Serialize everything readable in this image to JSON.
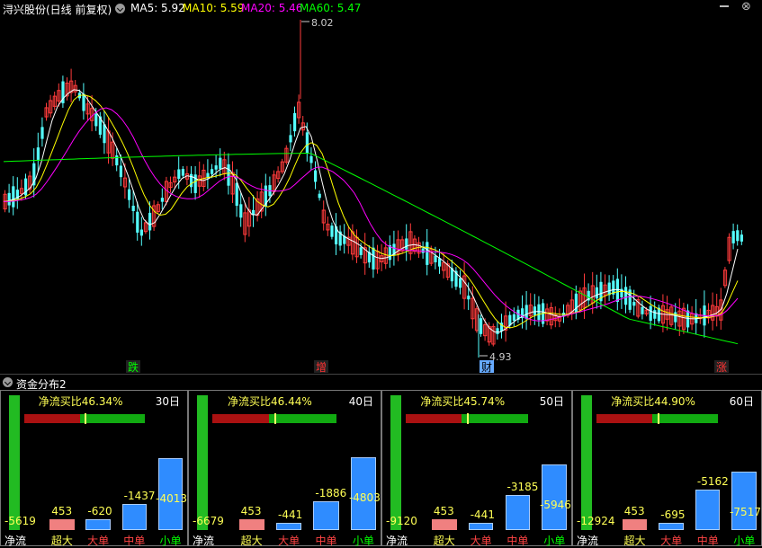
{
  "header": {
    "stock_name": "浔兴股份(日线 前复权)",
    "ma5": "MA5: 5.92",
    "ma10": "MA10: 5.59",
    "ma20": "MA20: 5.46",
    "ma60": "MA60: 5.47",
    "colors": {
      "ma5": "#ffffff",
      "ma10": "#ffff00",
      "ma20": "#ff00ff",
      "ma60": "#00ff00"
    }
  },
  "kline": {
    "high_label": "8.02",
    "low_label": "4.93",
    "markers": [
      {
        "text": "跌",
        "color": "#00ff00",
        "bg": "#222"
      },
      {
        "text": "增",
        "color": "#ff3333",
        "bg": "#222"
      },
      {
        "text": "财",
        "color": "#000000",
        "bg": "#66aaff"
      },
      {
        "text": "涨",
        "color": "#ff3333",
        "bg": "#222"
      }
    ]
  },
  "fund_section": {
    "title": "资金分布2",
    "panels": [
      {
        "title": "净流买比46.34%",
        "days": "30日",
        "bars": [
          {
            "label": "净流",
            "value": "-5619"
          },
          {
            "label": "超大",
            "value": "453"
          },
          {
            "label": "大单",
            "value": "-620"
          },
          {
            "label": "中单",
            "value": "-1437"
          },
          {
            "label": "小单",
            "value": "-4013"
          }
        ]
      },
      {
        "title": "净流买比46.44%",
        "days": "40日",
        "bars": [
          {
            "label": "净流",
            "value": "-6679"
          },
          {
            "label": "超大",
            "value": "453"
          },
          {
            "label": "大单",
            "value": "-441"
          },
          {
            "label": "中单",
            "value": "-1886"
          },
          {
            "label": "小单",
            "value": "-4803"
          }
        ]
      },
      {
        "title": "净流买比45.74%",
        "days": "50日",
        "bars": [
          {
            "label": "净流",
            "value": "-9120"
          },
          {
            "label": "超大",
            "value": "453"
          },
          {
            "label": "大单",
            "value": "-441"
          },
          {
            "label": "中单",
            "value": "-3185"
          },
          {
            "label": "小单",
            "value": "-5946"
          }
        ]
      },
      {
        "title": "净流买比44.90%",
        "days": "60日",
        "bars": [
          {
            "label": "净流",
            "value": "-12924"
          },
          {
            "label": "超大",
            "value": "453"
          },
          {
            "label": "大单",
            "value": "-695"
          },
          {
            "label": "中单",
            "value": "-5162"
          },
          {
            "label": "小单",
            "value": "-7517"
          }
        ]
      }
    ]
  }
}
